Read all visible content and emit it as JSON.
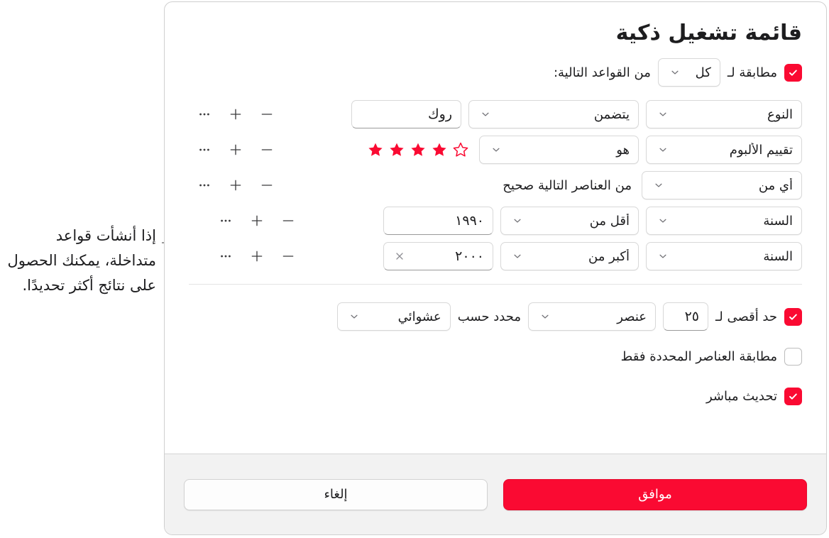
{
  "callout": {
    "text": "إذا أنشأت قواعد متداخلة، يمكنك الحصول على نتائج أكثر تحديدًا."
  },
  "dialog": {
    "title": "قائمة تشغيل ذكية",
    "match": {
      "checked_label": "مطابقة لـ",
      "scope_value": "كل",
      "suffix": "من القواعد التالية:"
    },
    "rules": [
      {
        "field": "النوع",
        "operator": "يتضمن",
        "value": "روك",
        "value_type": "text",
        "note": "",
        "stars": 0
      },
      {
        "field": "تقييم الألبوم",
        "operator": "هو",
        "value": "",
        "value_type": "stars",
        "note": "",
        "stars": 4,
        "stars_total": 5
      },
      {
        "field": "أي من",
        "operator": "",
        "value": "",
        "value_type": "none",
        "note": "من العناصر التالية صحيح",
        "stars": 0
      },
      {
        "field": "السنة",
        "operator": "أقل من",
        "value": "١٩٩٠",
        "value_type": "text",
        "note": "",
        "stars": 0
      },
      {
        "field": "السنة",
        "operator": "أكبر من",
        "value": "٢٠٠٠",
        "value_type": "text-clear",
        "note": "",
        "stars": 0
      }
    ],
    "row_actions": {
      "more_label": "…",
      "add_label": "+",
      "remove_label": "—"
    },
    "limit": {
      "label": "حد أقصى لـ",
      "count": "٢٥",
      "unit": "عنصر",
      "selected_by_label": "محدد حسب",
      "order": "عشوائي"
    },
    "match_selected_only": {
      "label": "مطابقة العناصر المحددة فقط",
      "checked": false
    },
    "live_updating": {
      "label": "تحديث مباشر",
      "checked": true
    },
    "footer": {
      "ok_label": "موافق",
      "cancel_label": "إلغاء"
    }
  },
  "colors": {
    "accent_red": "#FA0A32",
    "star_red": "#FA0A32",
    "panel_border": "#CFCFCF",
    "footer_bg": "#F2F2F2",
    "divider": "#E4E4E4"
  }
}
